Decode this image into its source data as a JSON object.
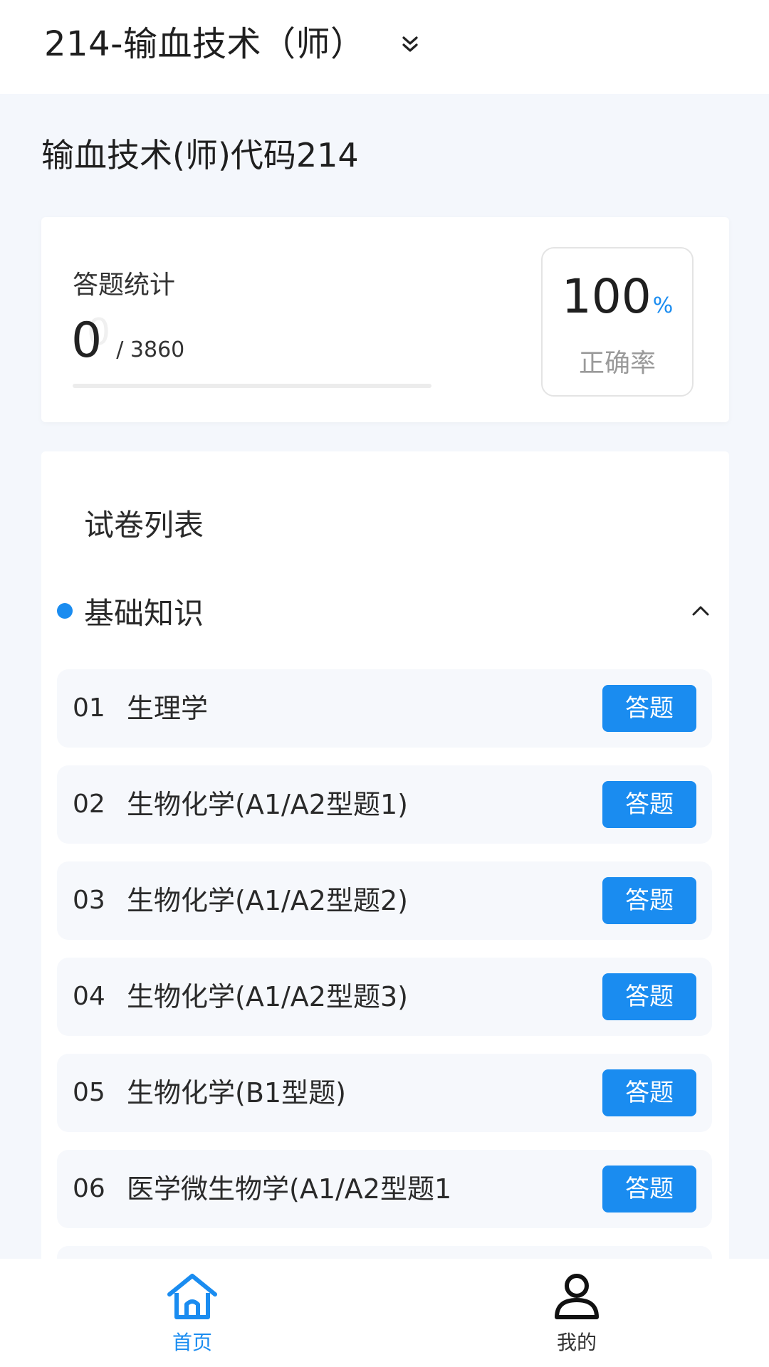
{
  "header": {
    "exam_title": "214-输血技术（师）",
    "dropdown_icon": "double-chevron-down-icon"
  },
  "subject": {
    "title": "输血技术(师)代码214"
  },
  "stats": {
    "label": "答题统计",
    "answered": "0",
    "total": "/ 3860",
    "progress_fraction": 0,
    "accuracy_value": "100",
    "accuracy_unit": "%",
    "accuracy_label": "正确率"
  },
  "papers": {
    "list_title": "试卷列表",
    "group": {
      "name": "基础知识",
      "collapse_icon": "chevron-up-icon"
    },
    "items": [
      {
        "num": "01",
        "name": "生理学",
        "action": "答题"
      },
      {
        "num": "02",
        "name": "生物化学(A1/A2型题1)",
        "action": "答题"
      },
      {
        "num": "03",
        "name": "生物化学(A1/A2型题2)",
        "action": "答题"
      },
      {
        "num": "04",
        "name": "生物化学(A1/A2型题3)",
        "action": "答题"
      },
      {
        "num": "05",
        "name": "生物化学(B1型题)",
        "action": "答题"
      },
      {
        "num": "06",
        "name": "医学微生物学(A1/A2型题1",
        "action": "答题"
      }
    ]
  },
  "bottom_nav": {
    "home": {
      "label": "首页",
      "icon": "home-icon"
    },
    "mine": {
      "label": "我的",
      "icon": "user-icon"
    }
  },
  "colors": {
    "accent": "#1a8cf0",
    "background": "#f4f7fc",
    "row_background": "#f6f8fc"
  }
}
